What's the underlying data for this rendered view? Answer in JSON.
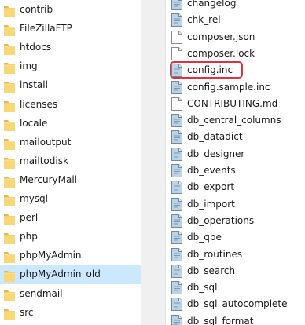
{
  "left_pane": {
    "folders": [
      {
        "label": "contrib",
        "selected": false
      },
      {
        "label": "FileZillaFTP",
        "selected": false
      },
      {
        "label": "htdocs",
        "selected": false
      },
      {
        "label": "img",
        "selected": false
      },
      {
        "label": "install",
        "selected": false
      },
      {
        "label": "licenses",
        "selected": false
      },
      {
        "label": "locale",
        "selected": false
      },
      {
        "label": "mailoutput",
        "selected": false
      },
      {
        "label": "mailtodisk",
        "selected": false
      },
      {
        "label": "MercuryMail",
        "selected": false
      },
      {
        "label": "mysql",
        "selected": false
      },
      {
        "label": "perl",
        "selected": false
      },
      {
        "label": "php",
        "selected": false
      },
      {
        "label": "phpMyAdmin",
        "selected": false
      },
      {
        "label": "phpMyAdmin_old",
        "selected": true
      },
      {
        "label": "sendmail",
        "selected": false
      },
      {
        "label": "src",
        "selected": false
      }
    ]
  },
  "right_pane": {
    "files": [
      {
        "label": "changelog",
        "icon": "php-file-icon"
      },
      {
        "label": "chk_rel",
        "icon": "php-file-icon"
      },
      {
        "label": "composer.json",
        "icon": "blank-file-icon"
      },
      {
        "label": "composer.lock",
        "icon": "blank-file-icon"
      },
      {
        "label": "config.inc",
        "icon": "php-file-icon",
        "highlighted": true
      },
      {
        "label": "config.sample.inc",
        "icon": "php-file-icon"
      },
      {
        "label": "CONTRIBUTING.md",
        "icon": "blank-file-icon"
      },
      {
        "label": "db_central_columns",
        "icon": "php-file-icon"
      },
      {
        "label": "db_datadict",
        "icon": "php-file-icon"
      },
      {
        "label": "db_designer",
        "icon": "php-file-icon"
      },
      {
        "label": "db_events",
        "icon": "php-file-icon"
      },
      {
        "label": "db_export",
        "icon": "php-file-icon"
      },
      {
        "label": "db_import",
        "icon": "php-file-icon"
      },
      {
        "label": "db_operations",
        "icon": "php-file-icon"
      },
      {
        "label": "db_qbe",
        "icon": "php-file-icon"
      },
      {
        "label": "db_routines",
        "icon": "php-file-icon"
      },
      {
        "label": "db_search",
        "icon": "php-file-icon"
      },
      {
        "label": "db_sql",
        "icon": "php-file-icon"
      },
      {
        "label": "db_sql_autocomplete",
        "icon": "php-file-icon"
      },
      {
        "label": "db_sql_format",
        "icon": "php-file-icon"
      }
    ]
  },
  "colors": {
    "selection": "#cce8ff",
    "highlight_border": "#e2303c",
    "folder_yellow": "#f8d775"
  }
}
